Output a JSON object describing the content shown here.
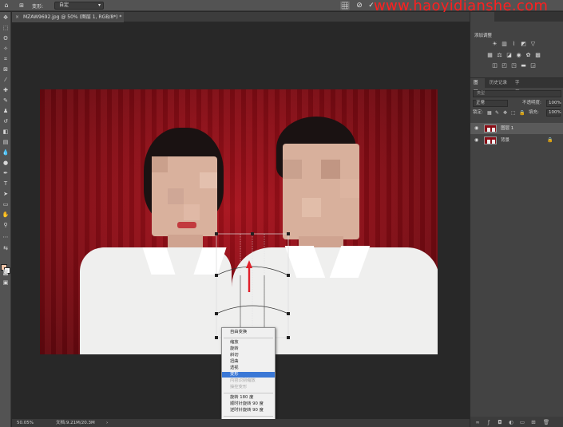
{
  "options_bar": {
    "tool_label": "变形:",
    "mode_value": "自定",
    "grid_icon": "grid-icon",
    "cancel_icon": "cancel-circle-icon",
    "commit_icon": "checkmark-icon"
  },
  "watermark": "www.haoyidianshe.com",
  "document": {
    "tab_title": "MZAW9692.jpg @ 50% (图层 1, RGB/8*) *"
  },
  "context_menu": {
    "items": [
      {
        "label": "自由变换",
        "state": "normal"
      },
      {
        "label": "缩放",
        "state": "normal"
      },
      {
        "label": "旋转",
        "state": "normal"
      },
      {
        "label": "斜切",
        "state": "normal"
      },
      {
        "label": "扭曲",
        "state": "normal"
      },
      {
        "label": "透视",
        "state": "normal"
      },
      {
        "label": "变形",
        "state": "selected"
      },
      {
        "label": "内容识别缩放",
        "state": "disabled"
      },
      {
        "label": "操控变形",
        "state": "disabled"
      },
      {
        "label": "旋转 180 度",
        "state": "normal"
      },
      {
        "label": "顺时针旋转 90 度",
        "state": "normal"
      },
      {
        "label": "逆时针旋转 90 度",
        "state": "normal"
      }
    ]
  },
  "status_bar": {
    "zoom": "50.05%",
    "doc_info": "文档:9.21M/20.3M",
    "arrow": "›"
  },
  "right_panel": {
    "top_tabs": [
      "",
      ""
    ],
    "adjustments_title": "添加调整",
    "adjust_icons_row1": [
      "brightness-icon",
      "levels-icon",
      "curves-icon",
      "exposure-icon",
      "vibrance-icon"
    ],
    "adjust_icons_row2": [
      "hue-icon",
      "balance-icon",
      "bw-icon",
      "photo-filter-icon",
      "channel-mixer-icon",
      "lookup-icon"
    ],
    "adjust_icons_row3": [
      "invert-icon",
      "posterize-icon",
      "threshold-icon",
      "gradient-map-icon",
      "selective-color-icon"
    ],
    "layers_tabs": [
      "图层",
      "历史记录",
      "字符"
    ],
    "search_placeholder": "类型",
    "blend_mode": "正常",
    "opacity_label": "不透明度:",
    "opacity_value": "100%",
    "lock_label": "锁定:",
    "fill_label": "填充:",
    "fill_value": "100%",
    "layers": [
      {
        "name": "图层 1",
        "active": true,
        "locked": false
      },
      {
        "name": "背景",
        "active": false,
        "locked": true
      }
    ]
  },
  "colors": {
    "accent": "#3b78d6",
    "foreground_swatch": "#f0c4a8",
    "background_swatch": "#ffffff",
    "arrow_red": "#e0202a"
  }
}
